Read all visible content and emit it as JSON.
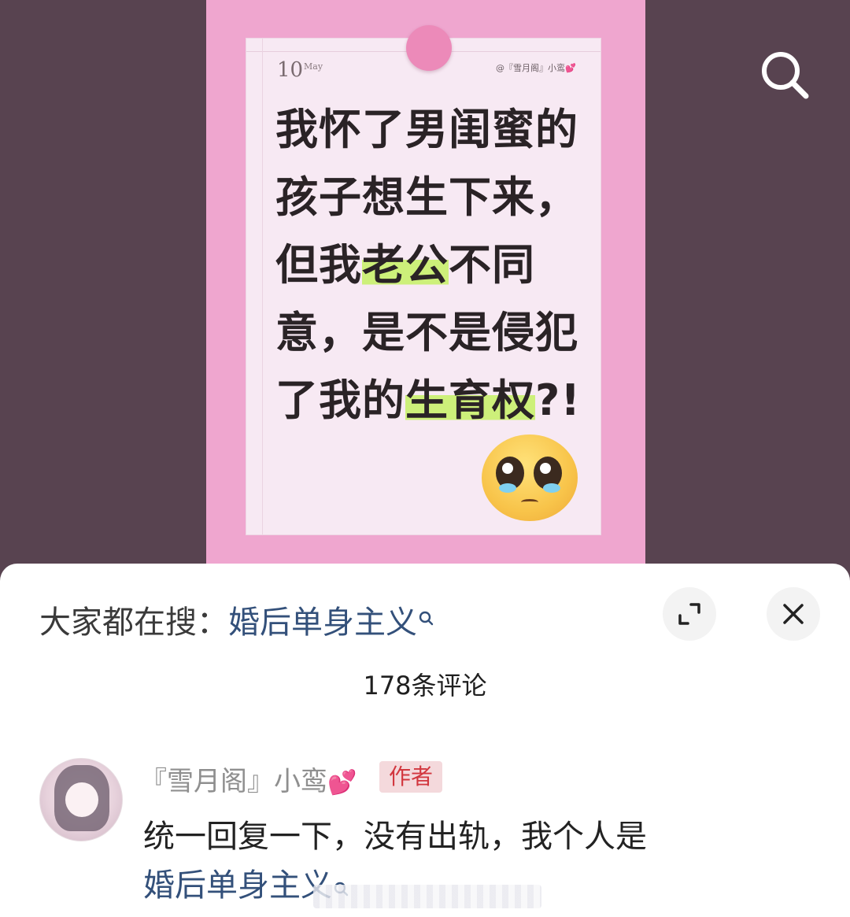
{
  "post": {
    "date_day": "10",
    "date_month": "May",
    "handle": "@『雪月阁』小鸾💕",
    "headline_parts": [
      "我怀了男闺蜜的",
      "孩子想生下来，",
      "但我",
      "老公",
      "不同",
      "意，是不是侵犯",
      "了我的",
      "生育权",
      "?!"
    ]
  },
  "header": {
    "search_icon": "search-icon"
  },
  "sheet": {
    "trending_prefix": "大家都在搜：",
    "trending_term": "婚后单身主义",
    "expand_icon": "expand-icon",
    "close_icon": "close-icon",
    "comment_count": "178条评论"
  },
  "comments": [
    {
      "username": "『雪月阁』小鸾",
      "user_emoji": "💕",
      "badge": "作者",
      "text": "统一回复一下，没有出轨，我个人是",
      "link": "婚后单身主义"
    }
  ],
  "colors": {
    "page_bg": "#584350",
    "post_bg": "#efa6cf",
    "highlight": "#cdf07a",
    "link": "#33507a",
    "badge_text": "#d2373f",
    "badge_bg": "#f4d9dc"
  }
}
